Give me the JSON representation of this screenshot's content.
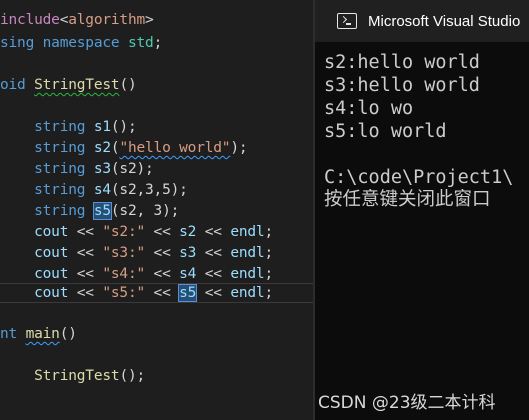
{
  "editor": {
    "include": {
      "directive": "include",
      "lt": "<",
      "header": "algorithm",
      "gt": ">"
    },
    "using_line": {
      "kw1": "sing",
      "kw2": "namespace",
      "ns": "std",
      "semi": ";"
    },
    "void_line": {
      "kw": "oid",
      "name": "StringTest",
      "parens": "()"
    },
    "decls": [
      {
        "type": "string",
        "var": "s1",
        "args": "();"
      },
      {
        "type": "string",
        "var": "s2",
        "open": "(",
        "str": "\"hello world\"",
        "close": ");"
      },
      {
        "type": "string",
        "var": "s3",
        "args": "(s2);"
      },
      {
        "type": "string",
        "var": "s4",
        "args": "(s2,3,5);"
      },
      {
        "type": "string",
        "var": "s5",
        "args": "(s2, 3);"
      }
    ],
    "couts": [
      {
        "cout": "cout",
        "op": " << ",
        "str": "\"s2:\"",
        "var": "s2",
        "endl": "endl",
        "semi": ";"
      },
      {
        "cout": "cout",
        "op": " << ",
        "str": "\"s3:\"",
        "var": "s3",
        "endl": "endl",
        "semi": ";"
      },
      {
        "cout": "cout",
        "op": " << ",
        "str": "\"s4:\"",
        "var": "s4",
        "endl": "endl",
        "semi": ";"
      },
      {
        "cout": "cout",
        "op": " << ",
        "str": "\"s5:\"",
        "var": "s5",
        "endl": "endl",
        "semi": ";"
      }
    ],
    "main_line": {
      "kw": "nt",
      "name": "main",
      "parens": "()"
    },
    "call_line": {
      "name": "StringTest",
      "args": "();"
    }
  },
  "console": {
    "title": "Microsoft Visual Studio",
    "icon": "console-app-icon",
    "lines": [
      "s2:hello world",
      "s3:hello world",
      "s4:lo wo",
      "s5:lo world",
      "",
      "C:\\code\\Project1\\",
      "按任意键关闭此窗口"
    ]
  },
  "watermark": "CSDN @23级二本计科"
}
